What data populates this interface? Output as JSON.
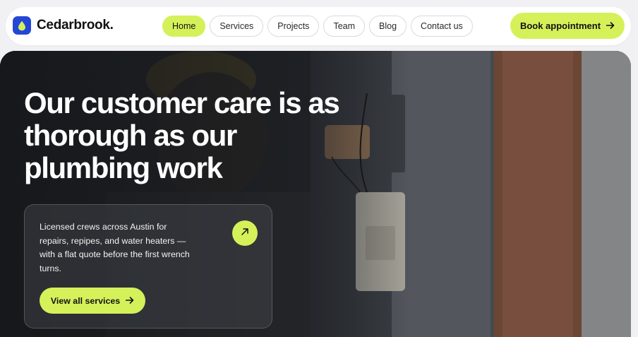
{
  "brand": {
    "name": "Cedarbrook",
    "dot": ".",
    "logo_icon": "water-drop-icon",
    "logo_color": "#2446d6"
  },
  "nav": {
    "items": [
      {
        "label": "Home",
        "active": true
      },
      {
        "label": "Services",
        "active": false
      },
      {
        "label": "Projects",
        "active": false
      },
      {
        "label": "Team",
        "active": false
      },
      {
        "label": "Blog",
        "active": false
      },
      {
        "label": "Contact us",
        "active": false
      }
    ]
  },
  "cta": {
    "book_label": "Book appointment",
    "icon": "arrow-right-icon"
  },
  "hero": {
    "title": "Our customer care is as thorough as our plumbing work",
    "description": "Licensed crews across Austin for repairs, repipes, and water heaters — with a flat quote before the first wrench turns.",
    "card_icon": "arrow-up-right-icon",
    "button_label": "View all services",
    "button_icon": "arrow-right-icon"
  },
  "colors": {
    "accent": "#d4f15a",
    "brand_blue": "#2446d6",
    "page_background": "#f1f1f3"
  }
}
